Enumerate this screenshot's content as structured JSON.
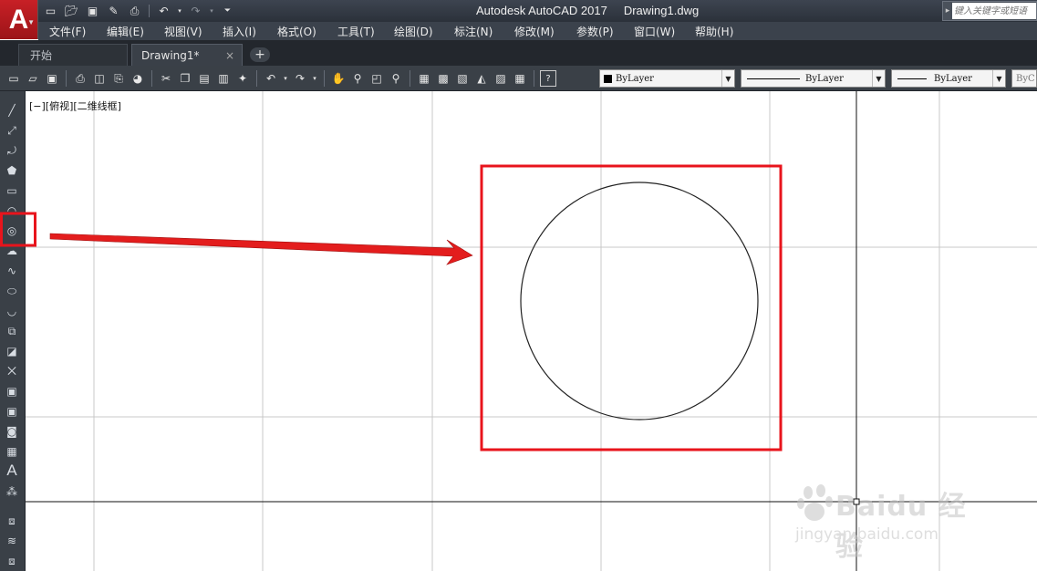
{
  "titlebar": {
    "app_letter": "A",
    "app_name": "Autodesk AutoCAD 2017",
    "file_name": "Drawing1.dwg",
    "search_placeholder": "键入关键字或短语"
  },
  "quick_access": [
    "new-icon",
    "open-icon",
    "save-icon",
    "save-as-icon",
    "plot-icon",
    "undo-icon",
    "redo-icon",
    "customize-icon"
  ],
  "menu": {
    "items": [
      "文件(F)",
      "编辑(E)",
      "视图(V)",
      "插入(I)",
      "格式(O)",
      "工具(T)",
      "绘图(D)",
      "标注(N)",
      "修改(M)",
      "参数(P)",
      "窗口(W)",
      "帮助(H)"
    ]
  },
  "tabs": {
    "start": "开始",
    "drawing": "Drawing1*",
    "close_glyph": "×",
    "add_glyph": "+"
  },
  "properties": {
    "color": "ByLayer",
    "linetype": "ByLayer",
    "lineweight": "ByLayer",
    "plotstyle": "ByC"
  },
  "viewport": {
    "label": "[−][俯视][二维线框]"
  },
  "drawing": {
    "object": "circle",
    "highlight_color": "#e8141c"
  },
  "left_tools": [
    "line-icon",
    "construction-line-icon",
    "polyline-icon",
    "polygon-icon",
    "rectangle-icon",
    "arc-icon",
    "circle-icon",
    "revision-cloud-icon",
    "spline-icon",
    "ellipse-icon",
    "ellipse-arc-icon",
    "insert-block-icon",
    "make-block-icon",
    "point-icon",
    "hatch-icon",
    "gradient-icon",
    "region-icon",
    "table-icon",
    "mtext-icon",
    "add-selected-icon",
    "layer-icon",
    "match-properties-icon",
    "layer-states-icon"
  ],
  "watermark": {
    "main": "Baidu 经验",
    "sub": "jingyan.baidu.com"
  }
}
